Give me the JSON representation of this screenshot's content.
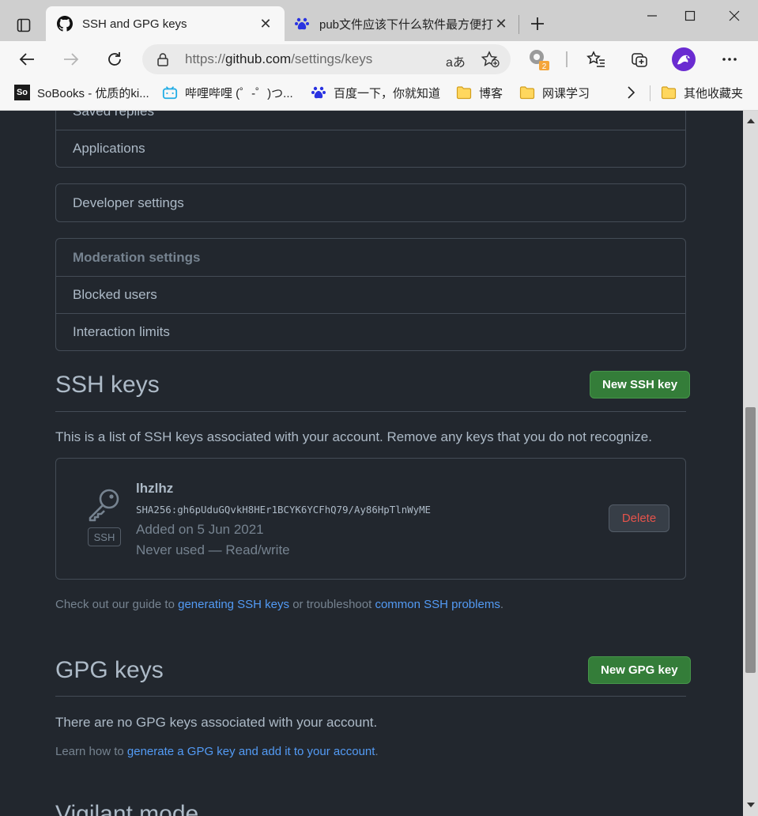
{
  "browser": {
    "tabs": [
      {
        "title": "SSH and GPG keys",
        "icon": "github-icon",
        "active": true
      },
      {
        "title": "pub文件应该下什么软件最方便打",
        "icon": "baidu-paw-icon",
        "active": false
      }
    ],
    "address": {
      "scheme": "https://",
      "host": "github.com",
      "path": "/settings/keys"
    },
    "read_aloud_glyph": "aあ",
    "extension_badge": "2",
    "bookmarks": [
      {
        "label": "SoBooks - 优质的ki...",
        "icon": "sobooks-icon",
        "icon_text": "So"
      },
      {
        "label": "哔哩哔哩 (゜-゜)つ...",
        "icon": "bilibili-icon"
      },
      {
        "label": "百度一下，你就知道",
        "icon": "baidu-paw-icon"
      },
      {
        "label": "博客",
        "icon": "folder-icon"
      },
      {
        "label": "网课学习",
        "icon": "folder-icon"
      },
      {
        "label": "其他收藏夹",
        "icon": "folder-icon"
      }
    ]
  },
  "sidebar": {
    "group1": [
      "Saved replies",
      "Applications"
    ],
    "group2": [
      "Developer settings"
    ],
    "moderation": {
      "header": "Moderation settings",
      "items": [
        "Blocked users",
        "Interaction limits"
      ]
    }
  },
  "ssh": {
    "heading": "SSH keys",
    "new_button": "New SSH key",
    "description": "This is a list of SSH keys associated with your account. Remove any keys that you do not recognize.",
    "keys": [
      {
        "title": "lhzlhz",
        "fingerprint": "SHA256:gh6pUduGQvkH8HEr1BCYK6YCFhQ79/Ay86HpTlnWyME",
        "added": "Added on 5 Jun 2021",
        "usage": "Never used — Read/write",
        "badge": "SSH",
        "delete_label": "Delete"
      }
    ],
    "guide": {
      "prefix": "Check out our guide to ",
      "link1": "generating SSH keys",
      "middle": " or troubleshoot ",
      "link2": "common SSH problems",
      "suffix": "."
    }
  },
  "gpg": {
    "heading": "GPG keys",
    "new_button": "New GPG key",
    "empty": "There are no GPG keys associated with your account.",
    "learn": {
      "prefix": "Learn how to ",
      "link": "generate a GPG key and add it to your account",
      "suffix": "."
    }
  },
  "next_section": {
    "heading": "Vigilant mode"
  },
  "colors": {
    "page_bg": "#22272e",
    "text": "#adbac7",
    "muted": "#768390",
    "border": "#444c56",
    "link": "#539bf5",
    "green": "#347d39",
    "danger": "#e5534b"
  }
}
